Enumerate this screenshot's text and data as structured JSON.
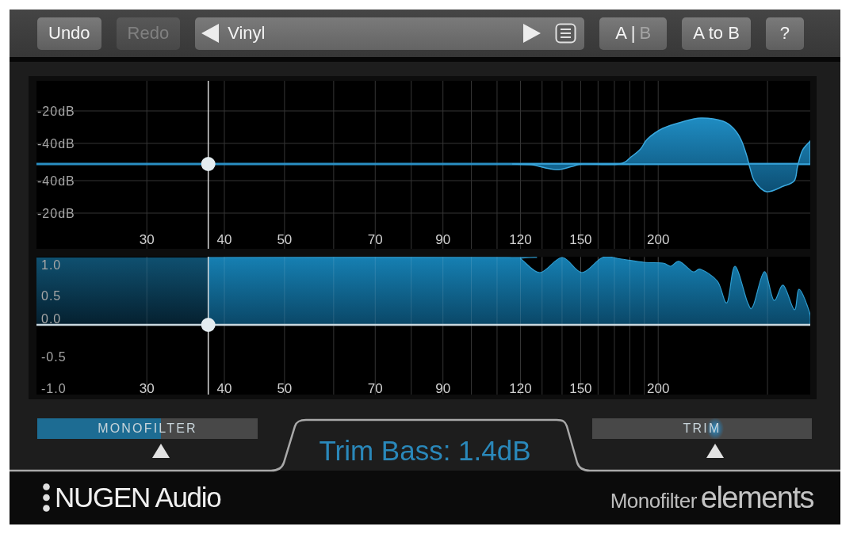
{
  "toolbar": [
    {
      "kind": "button",
      "label": "Undo",
      "disabled": false
    },
    {
      "kind": "button",
      "label": "Redo",
      "disabled": true
    },
    {
      "kind": "preset",
      "name": "Vinyl"
    },
    {
      "kind": "ab",
      "options": [
        {
          "label": "A",
          "selected": true
        },
        {
          "label": "B",
          "selected": false
        }
      ],
      "separator": "|"
    },
    {
      "kind": "button",
      "label": "A to B",
      "disabled": false
    },
    {
      "kind": "button",
      "label": "?",
      "disabled": false
    }
  ],
  "graphs": [
    {
      "kind": "response",
      "y_labels": [
        "-20dB",
        "-40dB",
        "-40dB",
        "-20dB"
      ],
      "x_labels": [
        "30",
        "40",
        "50",
        "70",
        "90",
        "120",
        "150",
        "200"
      ]
    },
    {
      "kind": "stereo_width",
      "y_labels": [
        "1.0",
        "0.5",
        "0.0",
        "-0.5",
        "-1.0"
      ],
      "x_labels": [
        "30",
        "40",
        "50",
        "70",
        "90",
        "120",
        "150",
        "200"
      ]
    }
  ],
  "crossover": {
    "level": 0.222
  },
  "sliders": [
    {
      "kind": "fill",
      "label": "MONOFILTER",
      "level": 0.56
    },
    {
      "kind": "thumb",
      "label": "TRIM",
      "level": 0.56
    }
  ],
  "readout": "Trim Bass: 1.4dB",
  "footer": {
    "brand": "NUGEN Audio",
    "product": "Monofilter",
    "edition": "elements"
  }
}
